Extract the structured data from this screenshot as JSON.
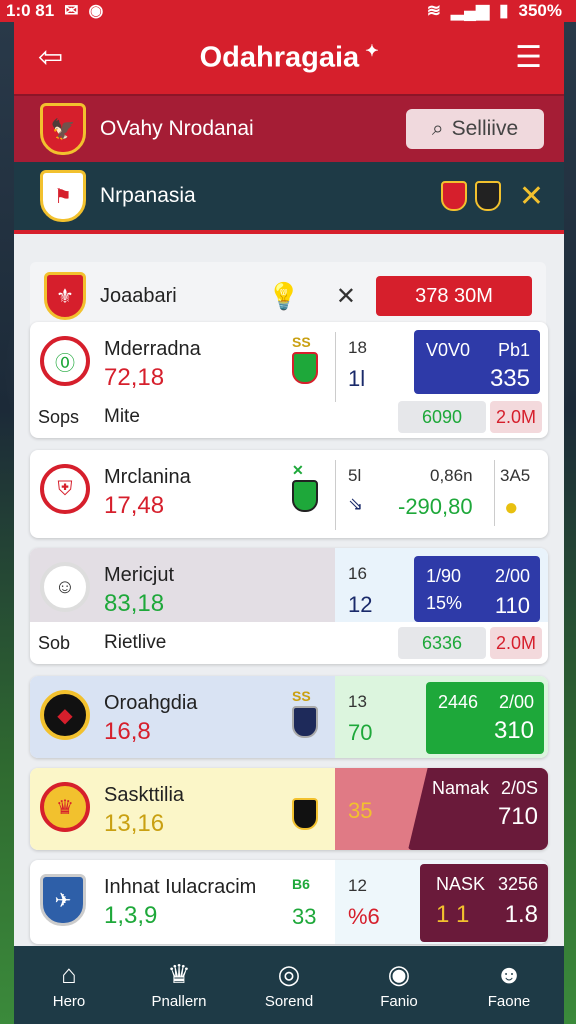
{
  "status_bar": {
    "time": "1:0 81",
    "battery": "350%"
  },
  "header": {
    "title": "Odahragaia",
    "flag": "✦"
  },
  "subheader": {
    "team_name": "OVahy Nrodanai",
    "search_label": "Selliive"
  },
  "league": {
    "name": "Nrpanasia"
  },
  "top_row": {
    "name": "Joaabari",
    "value": "378 30M"
  },
  "matches": [
    {
      "name": "Mderradna",
      "score": "72,18",
      "badge_label": "SS",
      "num1": "18",
      "num2": "1l",
      "box_l1a": "V0V0",
      "box_l1b": "Pb1",
      "box_l2": "335",
      "foot_label": "Sops",
      "foot_label2": "Mite",
      "chip1": "6090",
      "chip2": "2.0M"
    },
    {
      "name": "Mrclanina",
      "score": "17,48",
      "badge_label": "✕",
      "num1": "5l",
      "num2": "⇘",
      "right_top": "0,86n",
      "right_val": "-290,80",
      "right_top2": "3A5"
    },
    {
      "name": "Mericjut",
      "score": "83,18",
      "num1": "16",
      "num2": "12",
      "box_l1a": "1/90",
      "box_l1b": "2/00",
      "box_l2a": "15%",
      "box_l2b": "110",
      "foot_label": "Sob",
      "foot_label2": "Rietlive",
      "chip1": "6336",
      "chip2": "2.0M"
    },
    {
      "name": "Oroahgdia",
      "score": "16,8",
      "badge_label": "SS",
      "num1": "13",
      "num2": "70",
      "box_l1a": "2446",
      "box_l1b": "2/00",
      "box_l2": "310"
    },
    {
      "name": "Saskttilia",
      "score": "13,16",
      "num2": "35",
      "box_l1a": "Namak",
      "box_l1b": "2/0S",
      "box_l2": "710"
    },
    {
      "name": "Inhnat Iulacracim",
      "score": "1,3,9",
      "badge_label": "B6",
      "num1": "12",
      "num2": "%6",
      "num_b": "33",
      "box_l1a": "NASK",
      "box_l1b": "3256",
      "box_l2a": "1 1",
      "box_l2b": "1.8"
    }
  ],
  "nav": [
    {
      "label": "Hero",
      "icon": "home-icon"
    },
    {
      "label": "Pnallern",
      "icon": "trophy-icon"
    },
    {
      "label": "Sorend",
      "icon": "ball-icon"
    },
    {
      "label": "Fanio",
      "icon": "camera-icon"
    },
    {
      "label": "Faone",
      "icon": "profile-icon"
    }
  ],
  "colors": {
    "primary": "#d61f2c",
    "dark": "#1e3a46",
    "accent_blue": "#2e3aa8",
    "accent_green": "#1ea83a",
    "maroon": "#6a1a3a"
  }
}
